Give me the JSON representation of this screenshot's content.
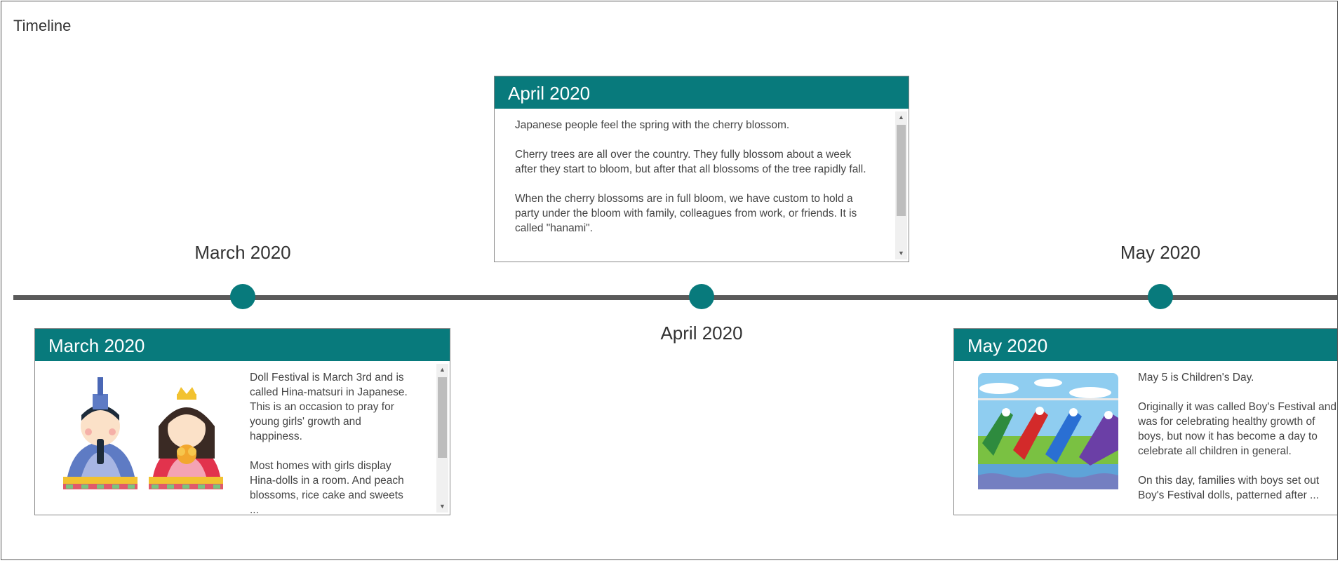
{
  "title": "Timeline",
  "accent_color": "#087a7c",
  "axis_color": "#5a5a5a",
  "items": [
    {
      "date_label": "March 2020",
      "card": {
        "header": "March 2020",
        "image": "hina-dolls-illustration",
        "paragraphs": [
          "Doll Festival is March 3rd and is called Hina-matsuri in Japanese. This is an occasion to pray for young girls' growth and happiness.",
          "Most homes with girls display Hina-dolls in a room. And peach blossoms, rice cake and sweets ..."
        ]
      }
    },
    {
      "date_label": "April 2020",
      "card": {
        "header": "April 2020",
        "paragraphs": [
          "Japanese people feel the spring with the cherry blossom.",
          "Cherry trees are all over the country. They fully blossom about a week after they start to bloom, but after that all blossoms of the tree rapidly fall.",
          "When the cherry blossoms are in full bloom, we have custom to hold a party under the bloom with family, colleagues from work, or friends. It is called \"hanami\"."
        ]
      }
    },
    {
      "date_label": "May 2020",
      "card": {
        "header": "May 2020",
        "image": "koinobori-carp-streamers-illustration",
        "paragraphs": [
          "May 5 is Children's Day.",
          "Originally it was called Boy's Festival and was for celebrating healthy growth of boys, but now it has become a day to celebrate all children in general.",
          "On this day, families with boys set out Boy's Festival dolls, patterned after ..."
        ]
      }
    }
  ]
}
